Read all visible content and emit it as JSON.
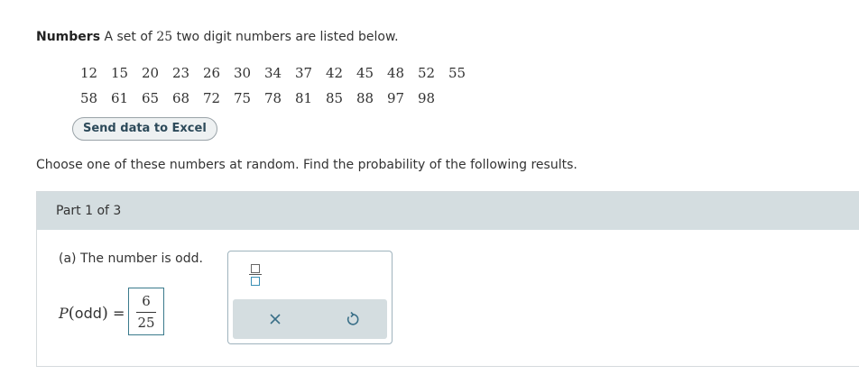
{
  "intro": {
    "bold": "Numbers",
    "text_before": " A set of ",
    "count": "25",
    "text_after": " two digit numbers are listed below."
  },
  "numbers": {
    "row1": [
      "12",
      "15",
      "20",
      "23",
      "26",
      "30",
      "34",
      "37",
      "42",
      "45",
      "48",
      "52",
      "55"
    ],
    "row2": [
      "58",
      "61",
      "65",
      "68",
      "72",
      "75",
      "78",
      "81",
      "85",
      "88",
      "97",
      "98"
    ]
  },
  "excel_button": "Send data to Excel",
  "instructions": "Choose one of these numbers at random. Find the probability of the following results.",
  "part": {
    "header": "Part 1 of 3",
    "question": "(a) The number is odd.",
    "prob_p": "P",
    "prob_open": "(",
    "prob_event": "odd",
    "prob_close": ")",
    "prob_equals": "=",
    "answer": {
      "numerator": "6",
      "denominator": "25"
    }
  },
  "toolbox": {
    "fraction_icon": "fraction-template-icon",
    "clear_icon": "close-x-icon",
    "undo_icon": "undo-icon"
  }
}
